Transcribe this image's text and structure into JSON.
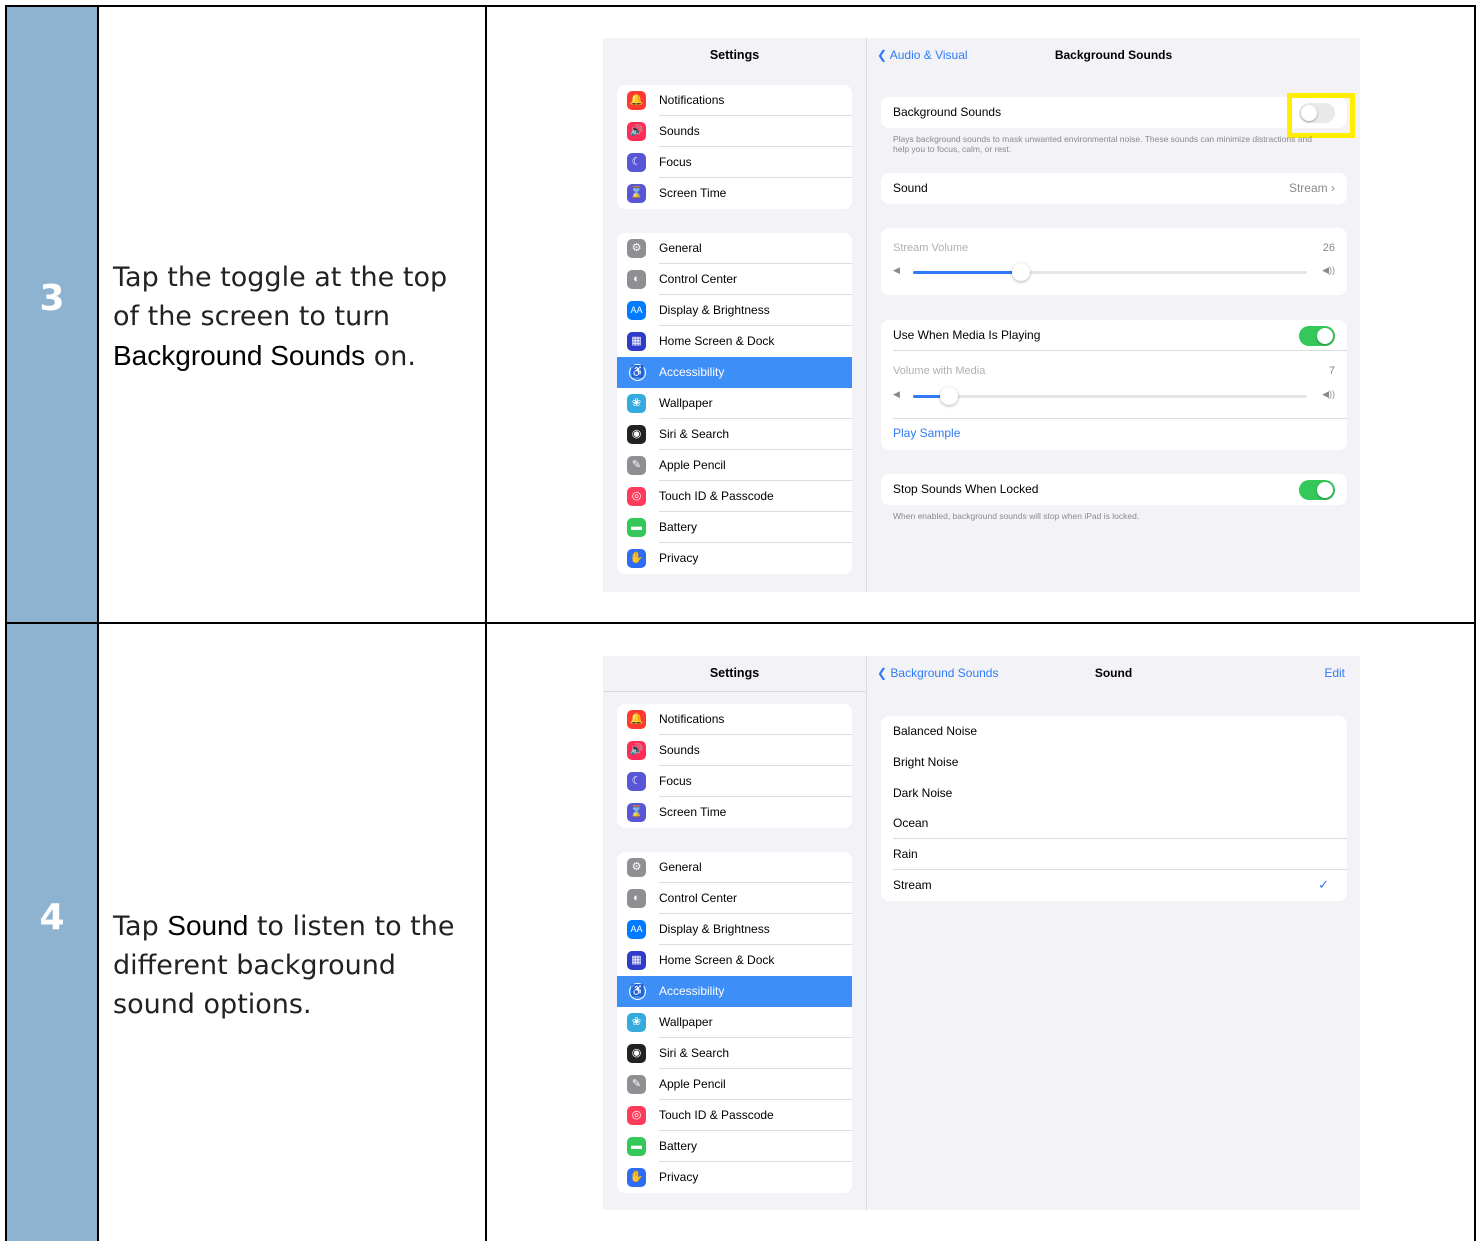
{
  "steps": [
    {
      "number": "3",
      "instruction": {
        "pre": "Tap the toggle at the top of the screen to turn ",
        "bold": "Background Sounds",
        "post": " on."
      },
      "screen": {
        "sidebar_title": "Settings",
        "nav_back": "Audio & Visual",
        "nav_title": "Background Sounds",
        "bg_sounds_label": "Background Sounds",
        "bg_sounds_desc": "Plays background sounds to mask unwanted environmental noise. These sounds can minimize distractions and help you to focus, calm, or rest.",
        "sound_label": "Sound",
        "sound_value": "Stream",
        "stream_volume_label": "Stream Volume",
        "stream_volume_value": "26",
        "use_media_label": "Use When Media Is Playing",
        "volume_media_label": "Volume with Media",
        "volume_media_value": "7",
        "play_sample": "Play Sample",
        "stop_locked_label": "Stop Sounds When Locked",
        "stop_locked_desc": "When enabled, background sounds will stop when iPad is locked."
      }
    },
    {
      "number": "4",
      "instruction": {
        "pre": "Tap ",
        "bold": "Sound",
        "post": " to listen to the different background sound options."
      },
      "screen": {
        "sidebar_title": "Settings",
        "nav_back": "Background Sounds",
        "nav_title": "Sound",
        "nav_edit": "Edit",
        "options": [
          "Balanced Noise",
          "Bright Noise",
          "Dark Noise",
          "Ocean",
          "Rain",
          "Stream"
        ],
        "checkmark": "✓"
      }
    }
  ],
  "sidebar": {
    "group1": [
      {
        "label": "Notifications",
        "icon": "notifications-icon",
        "color": "#ff3b30",
        "glyph": "🔔"
      },
      {
        "label": "Sounds",
        "icon": "sounds-icon",
        "color": "#ff2d55",
        "glyph": "🔊"
      },
      {
        "label": "Focus",
        "icon": "focus-icon",
        "color": "#5856d6",
        "glyph": "☾"
      },
      {
        "label": "Screen Time",
        "icon": "screen-time-icon",
        "color": "#5856d6",
        "glyph": "⌛"
      }
    ],
    "group2": [
      {
        "label": "General",
        "icon": "general-icon",
        "color": "#8e8e93",
        "glyph": "⚙"
      },
      {
        "label": "Control Center",
        "icon": "control-center-icon",
        "color": "#8e8e93",
        "glyph": "◐"
      },
      {
        "label": "Display & Brightness",
        "icon": "display-icon",
        "color": "#007aff",
        "glyph": "AA"
      },
      {
        "label": "Home Screen & Dock",
        "icon": "home-screen-icon",
        "color": "#2f3cc9",
        "glyph": "▦"
      },
      {
        "label": "Accessibility",
        "icon": "accessibility-icon",
        "color": "#3e8ef7",
        "glyph": "♿",
        "active": true
      },
      {
        "label": "Wallpaper",
        "icon": "wallpaper-icon",
        "color": "#35aadc",
        "glyph": "❀"
      },
      {
        "label": "Siri & Search",
        "icon": "siri-icon",
        "color": "#222222",
        "glyph": "◉"
      },
      {
        "label": "Apple Pencil",
        "icon": "pencil-icon",
        "color": "#8e8e93",
        "glyph": "✎"
      },
      {
        "label": "Touch ID & Passcode",
        "icon": "touch-id-icon",
        "color": "#ff3b5c",
        "glyph": "◎"
      },
      {
        "label": "Battery",
        "icon": "battery-icon",
        "color": "#34c759",
        "glyph": "▬"
      },
      {
        "label": "Privacy",
        "icon": "privacy-icon",
        "color": "#2f6cf5",
        "glyph": "✋"
      }
    ]
  },
  "colors": {
    "step_bg": "#8db3d0",
    "highlight": "#ffee00",
    "toggle_on": "#34c759",
    "ios_blue": "#2f7bf5"
  }
}
